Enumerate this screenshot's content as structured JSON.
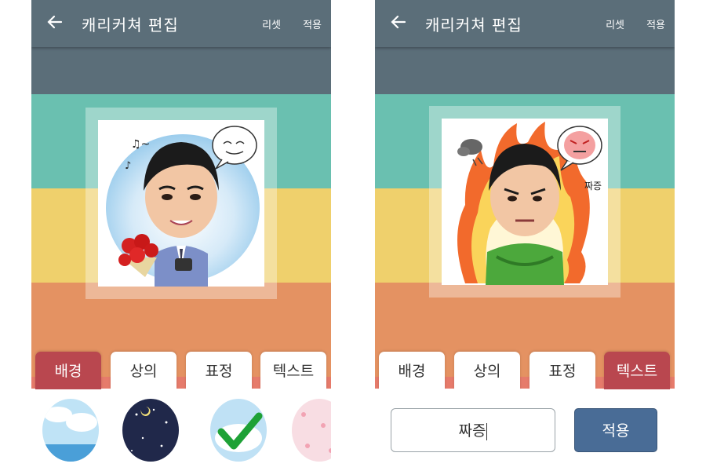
{
  "left_screen": {
    "title": "캐리커쳐 편집",
    "reset_label": "리셋",
    "apply_label": "적용",
    "tabs": [
      "배경",
      "상의",
      "표정",
      "텍스트"
    ],
    "active_tab": "배경",
    "thumbnails": [
      "sky-sea",
      "night-stars",
      "clouds-selected",
      "pink-flowers"
    ],
    "selected_thumbnail": "clouds-selected",
    "caricature": {
      "music_note_text": "♫~"
    }
  },
  "right_screen": {
    "title": "캐리커쳐 편집",
    "reset_label": "리셋",
    "apply_label": "적용",
    "tabs": [
      "배경",
      "상의",
      "표정",
      "텍스트"
    ],
    "active_tab": "텍스트",
    "text_input_value": "짜증",
    "apply_button_label": "적용",
    "caricature": {
      "caption": "짜증"
    }
  },
  "colors": {
    "appbar": "#5b6e79",
    "teal": "#6ac0b0",
    "yellow": "#efd06c",
    "orange": "#e49262",
    "active_tab": "#b9474f",
    "apply_button": "#496c96"
  }
}
